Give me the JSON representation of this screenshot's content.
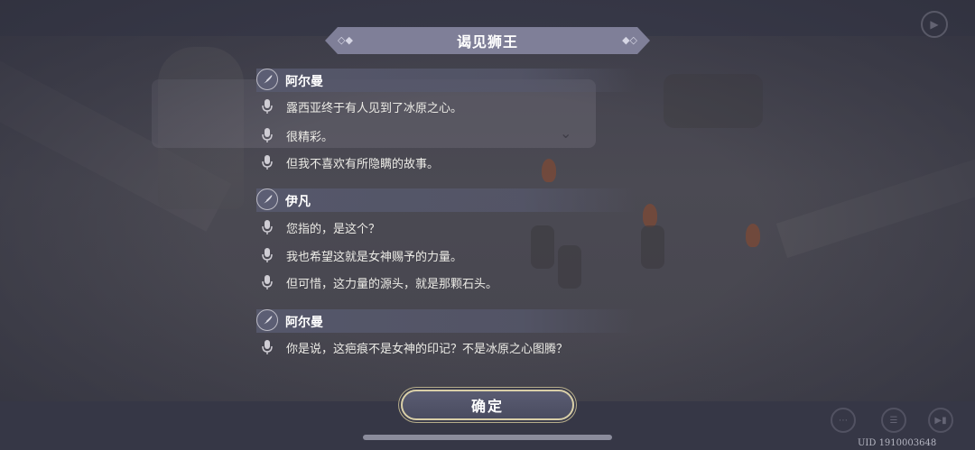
{
  "header": {
    "title": "谒见狮王"
  },
  "dialog": [
    {
      "speaker": "阿尔曼",
      "lines": [
        "露西亚终于有人见到了冰原之心。",
        "很精彩。",
        "但我不喜欢有所隐瞒的故事。"
      ]
    },
    {
      "speaker": "伊凡",
      "lines": [
        "您指的，是这个？",
        "我也希望这就是女神赐予的力量。",
        "但可惜，这力量的源头，就是那颗石头。"
      ]
    },
    {
      "speaker": "阿尔曼",
      "lines": [
        "你是说，这疤痕不是女神的印记？不是冰原之心图腾？"
      ]
    }
  ],
  "footer": {
    "confirm_label": "确定",
    "uid": "UID 1910003648"
  },
  "icons": {
    "speaker": "quill-icon",
    "voice": "microphone-icon",
    "top_right": "play-icon",
    "bottom": [
      "more-icon",
      "log-icon",
      "skip-icon"
    ]
  },
  "colors": {
    "banner": "#7f7f98",
    "speaker_bar": "#56586c",
    "confirm_border": "#d9cfa8",
    "background": "#3a3b4b"
  }
}
